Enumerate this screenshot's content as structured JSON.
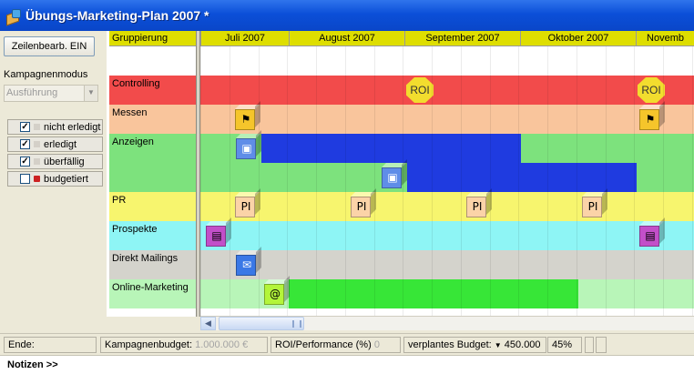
{
  "window": {
    "title": "Übungs-Marketing-Plan 2007 *"
  },
  "left_panel": {
    "row_edit_button": "Zeilenbearb. EIN",
    "campaign_mode_label": "Kampagnenmodus",
    "campaign_mode_value": "Ausführung",
    "filters": [
      {
        "label": "nicht erledigt",
        "checked": true
      },
      {
        "label": "erledigt",
        "checked": true
      },
      {
        "label": "überfällig",
        "checked": true
      },
      {
        "label": "budgetiert",
        "checked": false
      }
    ]
  },
  "timeline": {
    "group_header": "Gruppierung",
    "months": [
      "Juli 2007",
      "August 2007",
      "September 2007",
      "Oktober 2007",
      "Novemb"
    ]
  },
  "rows": [
    {
      "label": "Controlling",
      "color": "#f24b4b"
    },
    {
      "label": "Messen",
      "color": "#f9c59c"
    },
    {
      "label": "Anzeigen",
      "color": "#7de27d"
    },
    {
      "label": "",
      "color": "#7de27d"
    },
    {
      "label": "PR",
      "color": "#f7f56e"
    },
    {
      "label": "Prospekte",
      "color": "#8ef5f5"
    },
    {
      "label": "Direkt Mailings",
      "color": "#d4d3cc"
    },
    {
      "label": "Online-Marketing",
      "color": "#b8f5b8"
    }
  ],
  "markers": {
    "roi": "ROI",
    "pr": "PI",
    "online": "@"
  },
  "status_bar": {
    "end_label": "Ende:",
    "budget_label": "Kampagnenbudget:",
    "budget_value": "1.000.000 €",
    "roi_label": "ROI/Performance (%)",
    "roi_value": "0",
    "planned_label": "verplantes Budget:",
    "planned_value": "450.000",
    "percent": "45%"
  },
  "notes": {
    "label": "Notizen >>"
  }
}
